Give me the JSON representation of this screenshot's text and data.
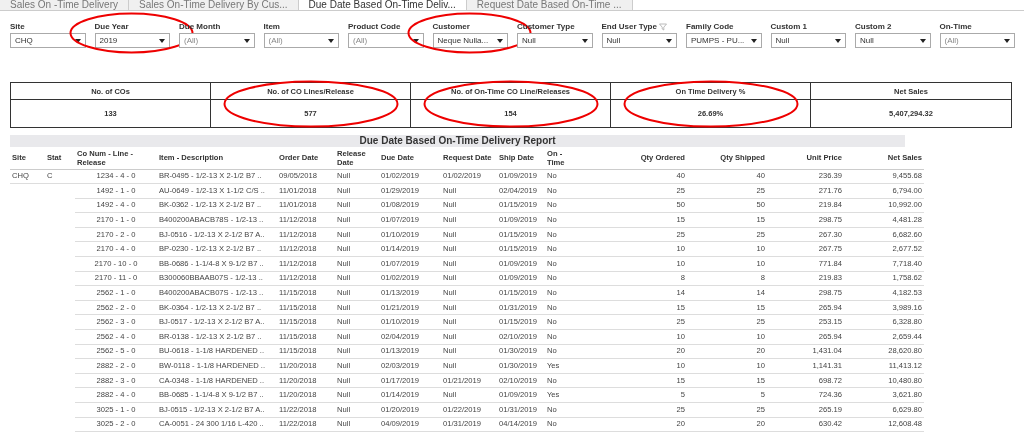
{
  "tabs": [
    {
      "label": "Sales On -Time Delivery",
      "selected": false
    },
    {
      "label": "Sales On-Time Delivery By Cus...",
      "selected": false
    },
    {
      "label": "Due Date Based On-Time Deliv...",
      "selected": true
    },
    {
      "label": "Request Date Based On-Time ...",
      "selected": false
    }
  ],
  "filters": [
    {
      "label": "Site",
      "value": "CHQ",
      "circled": false,
      "grey": false
    },
    {
      "label": "Due Year",
      "value": "2019",
      "circled": true,
      "grey": false
    },
    {
      "label": "Due Month",
      "value": "(All)",
      "circled": false,
      "grey": true
    },
    {
      "label": "Item",
      "value": "(All)",
      "circled": false,
      "grey": true
    },
    {
      "label": "Product Code",
      "value": "(All)",
      "circled": false,
      "grey": true
    },
    {
      "label": "Customer",
      "value": "Neque Nulla...",
      "circled": true,
      "grey": false
    },
    {
      "label": "Customer Type",
      "value": "Null",
      "circled": false,
      "grey": false
    },
    {
      "label": "End User Type",
      "value": "Null",
      "circled": false,
      "grey": false,
      "filtered": true
    },
    {
      "label": "Family Code",
      "value": "PUMPS - PU...",
      "circled": false,
      "grey": false
    },
    {
      "label": "Custom 1",
      "value": "Null",
      "circled": false,
      "grey": false
    },
    {
      "label": "Custom 2",
      "value": "Null",
      "circled": false,
      "grey": false
    },
    {
      "label": "On-Time",
      "value": "(All)",
      "circled": false,
      "grey": true
    }
  ],
  "kpis": [
    {
      "label": "No. of COs",
      "value": "133",
      "circled": false
    },
    {
      "label": "No. of CO Lines/Release",
      "value": "577",
      "circled": true
    },
    {
      "label": "No. of On-Time CO Line/Releases",
      "value": "154",
      "circled": true
    },
    {
      "label": "On Time Delivery %",
      "value": "26.69%",
      "circled": true
    },
    {
      "label": "Net Sales",
      "value": "5,407,294.32",
      "circled": false
    }
  ],
  "report": {
    "title": "Due Date Based On-Time Delivery Report",
    "columns": [
      "Site",
      "Stat",
      "Co Num - Line - Release",
      "Item - Description",
      "Order Date",
      "Release Date",
      "Due Date",
      "Request Date",
      "Ship Date",
      "On - Time",
      "Qty Ordered",
      "Qty Shipped",
      "Unit Price",
      "Net Sales"
    ],
    "rows": [
      [
        "CHQ",
        "C",
        "1234 - 4 - 0",
        "BR-0495 - 1/2-13 X 2-1/2 B7 ..",
        "09/05/2018",
        "Null",
        "01/02/2019",
        "01/02/2019",
        "01/09/2019",
        "No",
        "40",
        "40",
        "236.39",
        "9,455.68"
      ],
      [
        "",
        "",
        "1492 - 1 - 0",
        "AU-0649 - 1/2-13 X 1-1/2 C/S ..",
        "11/01/2018",
        "Null",
        "01/29/2019",
        "Null",
        "02/04/2019",
        "No",
        "25",
        "25",
        "271.76",
        "6,794.00"
      ],
      [
        "",
        "",
        "1492 - 4 - 0",
        "BK-0362 - 1/2-13 X 2-1/2 B7 ..",
        "11/01/2018",
        "Null",
        "01/08/2019",
        "Null",
        "01/15/2019",
        "No",
        "50",
        "50",
        "219.84",
        "10,992.00"
      ],
      [
        "",
        "",
        "2170 - 1 - 0",
        "B400200ABACB78S - 1/2-13 ..",
        "11/12/2018",
        "Null",
        "01/07/2019",
        "Null",
        "01/09/2019",
        "No",
        "15",
        "15",
        "298.75",
        "4,481.28"
      ],
      [
        "",
        "",
        "2170 - 2 - 0",
        "BJ-0516 - 1/2-13 X 2-1/2 B7 A..",
        "11/12/2018",
        "Null",
        "01/10/2019",
        "Null",
        "01/15/2019",
        "No",
        "25",
        "25",
        "267.30",
        "6,682.60"
      ],
      [
        "",
        "",
        "2170 - 4 - 0",
        "BP-0230 - 1/2-13 X 2-1/2 B7 ..",
        "11/12/2018",
        "Null",
        "01/14/2019",
        "Null",
        "01/15/2019",
        "No",
        "10",
        "10",
        "267.75",
        "2,677.52"
      ],
      [
        "",
        "",
        "2170 - 10 - 0",
        "BB-0686 - 1-1/4-8 X 9-1/2 B7 ..",
        "11/12/2018",
        "Null",
        "01/07/2019",
        "Null",
        "01/09/2019",
        "No",
        "10",
        "10",
        "771.84",
        "7,718.40"
      ],
      [
        "",
        "",
        "2170 - 11 - 0",
        "B300060BBAAB07S - 1/2-13 ..",
        "11/12/2018",
        "Null",
        "01/02/2019",
        "Null",
        "01/09/2019",
        "No",
        "8",
        "8",
        "219.83",
        "1,758.62"
      ],
      [
        "",
        "",
        "2562 - 1 - 0",
        "B400200ABACB07S - 1/2-13 ..",
        "11/15/2018",
        "Null",
        "01/13/2019",
        "Null",
        "01/15/2019",
        "No",
        "14",
        "14",
        "298.75",
        "4,182.53"
      ],
      [
        "",
        "",
        "2562 - 2 - 0",
        "BK-0364 - 1/2-13 X 2-1/2 B7 ..",
        "11/15/2018",
        "Null",
        "01/21/2019",
        "Null",
        "01/31/2019",
        "No",
        "15",
        "15",
        "265.94",
        "3,989.16"
      ],
      [
        "",
        "",
        "2562 - 3 - 0",
        "BJ-0517 - 1/2-13 X 2-1/2 B7 A..",
        "11/15/2018",
        "Null",
        "01/10/2019",
        "Null",
        "01/15/2019",
        "No",
        "25",
        "25",
        "253.15",
        "6,328.80"
      ],
      [
        "",
        "",
        "2562 - 4 - 0",
        "BR-0138 - 1/2-13 X 2-1/2 B7 ..",
        "11/15/2018",
        "Null",
        "02/04/2019",
        "Null",
        "02/10/2019",
        "No",
        "10",
        "10",
        "265.94",
        "2,659.44"
      ],
      [
        "",
        "",
        "2562 - 5 - 0",
        "BU-0618 - 1-1/8 HARDENED ..",
        "11/15/2018",
        "Null",
        "01/13/2019",
        "Null",
        "01/30/2019",
        "No",
        "20",
        "20",
        "1,431.04",
        "28,620.80"
      ],
      [
        "",
        "",
        "2882 - 2 - 0",
        "BW-0118 - 1-1/8 HARDENED ..",
        "11/20/2018",
        "Null",
        "02/03/2019",
        "Null",
        "01/30/2019",
        "Yes",
        "10",
        "10",
        "1,141.31",
        "11,413.12"
      ],
      [
        "",
        "",
        "2882 - 3 - 0",
        "CA-0348 - 1-1/8 HARDENED ..",
        "11/20/2018",
        "Null",
        "01/17/2019",
        "01/21/2019",
        "02/10/2019",
        "No",
        "15",
        "15",
        "698.72",
        "10,480.80"
      ],
      [
        "",
        "",
        "2882 - 4 - 0",
        "BB-0685 - 1-1/4-8 X 9-1/2 B7 ..",
        "11/20/2018",
        "Null",
        "01/14/2019",
        "Null",
        "01/09/2019",
        "Yes",
        "5",
        "5",
        "724.36",
        "3,621.80"
      ],
      [
        "",
        "",
        "3025 - 1 - 0",
        "BJ-0515 - 1/2-13 X 2-1/2 B7 A..",
        "11/22/2018",
        "Null",
        "01/20/2019",
        "01/22/2019",
        "01/31/2019",
        "No",
        "25",
        "25",
        "265.19",
        "6,629.80"
      ],
      [
        "",
        "",
        "3025 - 2 - 0",
        "CA-0051 - 24 300 1/16 L-420 ..",
        "11/22/2018",
        "Null",
        "04/09/2019",
        "01/31/2019",
        "04/14/2019",
        "No",
        "20",
        "20",
        "630.42",
        "12,608.48"
      ]
    ]
  }
}
